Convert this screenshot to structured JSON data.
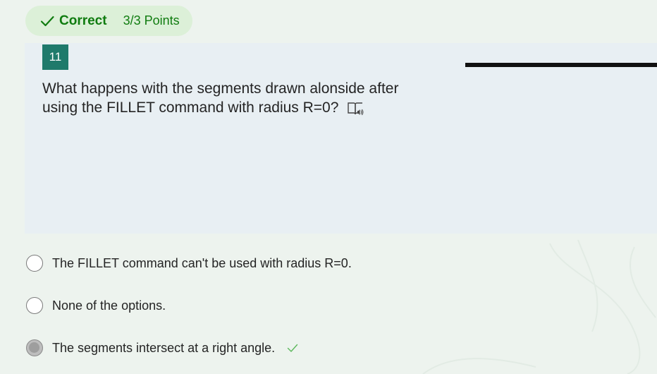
{
  "result": {
    "status": "Correct",
    "points": "3/3 Points",
    "icon": "check-icon",
    "color": "#107c10"
  },
  "question": {
    "number": "11",
    "text": "What happens with the segments drawn alonside after using the FILLET command with radius R=0?",
    "reader_icon": "immersive-reader-icon"
  },
  "options": [
    {
      "label": "The FILLET command can't be used with radius R=0.",
      "selected": false,
      "correct": false
    },
    {
      "label": "None of the options.",
      "selected": false,
      "correct": false
    },
    {
      "label": "The segments intersect at a right angle.",
      "selected": true,
      "correct": true
    }
  ],
  "colors": {
    "accent": "#1f7a6b",
    "pill_bg": "#dcf0d8",
    "card_bg": "#e8eff3"
  }
}
